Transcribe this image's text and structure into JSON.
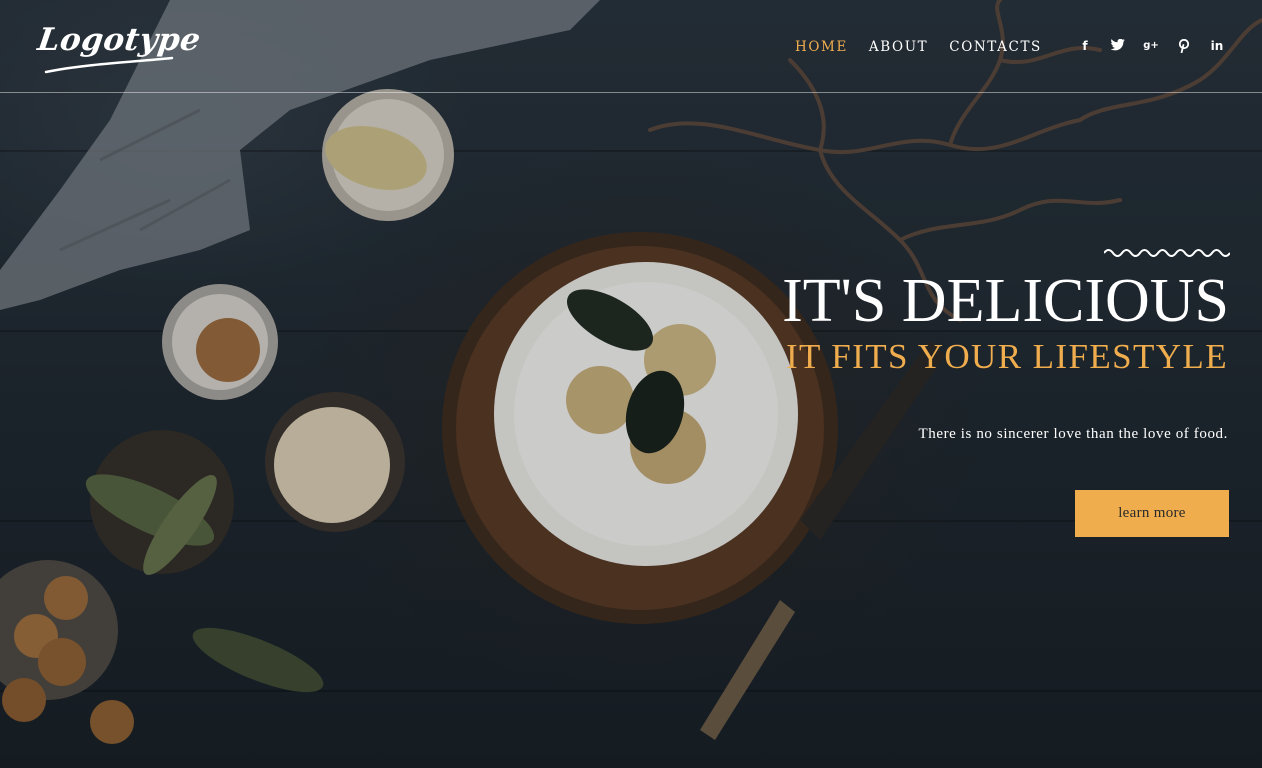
{
  "header": {
    "logo": "Logotype",
    "nav": [
      {
        "label": "HOME",
        "active": true
      },
      {
        "label": "ABOUT",
        "active": false
      },
      {
        "label": "CONTACTS",
        "active": false
      }
    ],
    "social": [
      "facebook-icon",
      "twitter-icon",
      "google-plus-icon",
      "pinterest-icon",
      "linkedin-icon"
    ],
    "social_glyphs": {
      "facebook": "f",
      "google_plus": "g+",
      "linkedin": "in"
    }
  },
  "hero": {
    "title": "IT'S DELICIOUS",
    "subtitle": "IT FITS YOUR LIFESTYLE",
    "text": "There is no sincerer love than the love of food.",
    "button_label": "learn more"
  },
  "colors": {
    "accent": "#f0ad4e",
    "text": "#ffffff",
    "background": "#1f2830"
  }
}
